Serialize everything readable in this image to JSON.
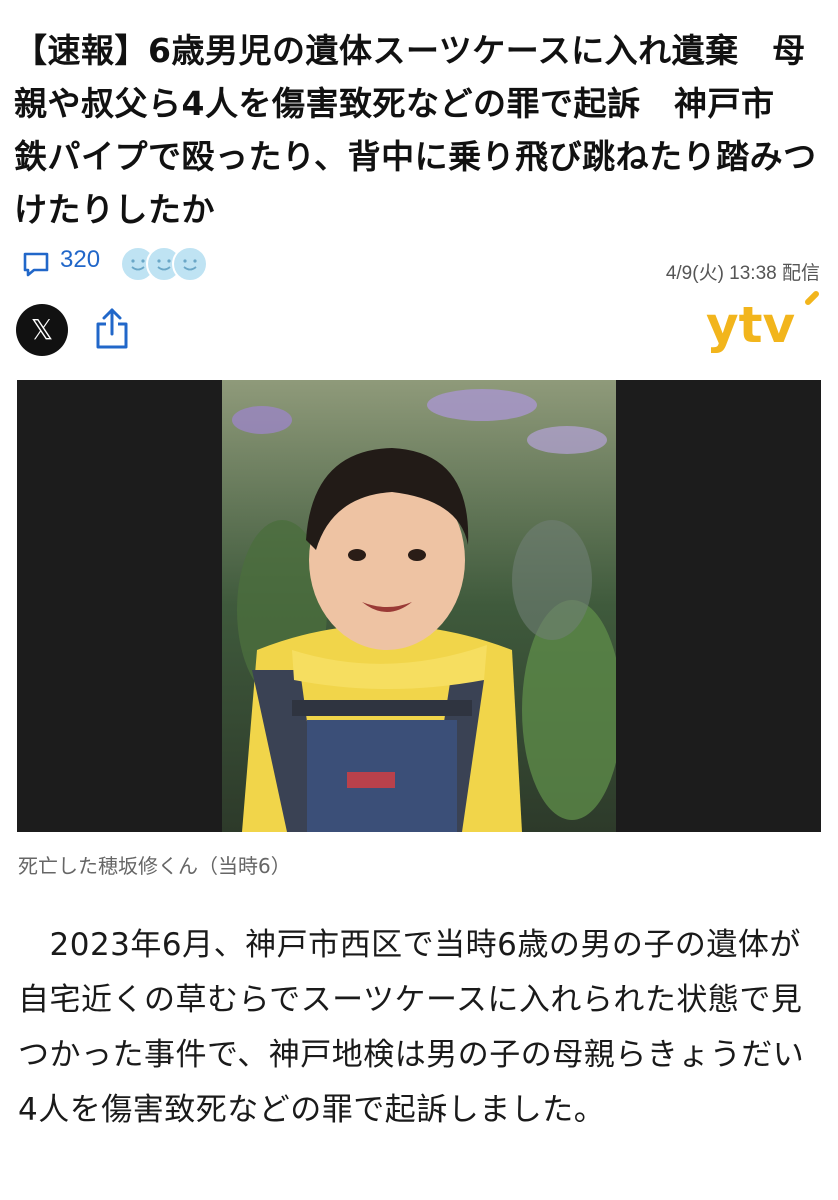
{
  "article": {
    "headline": "【速報】6歳男児の遺体スーツケースに入れ遺棄　母親や叔父ら4人を傷害致死などの罪で起訴　神戸市　鉄パイプで殴ったり、背中に乗り飛び跳ねたり踏みつけたりしたか",
    "comment_count": "320",
    "timestamp": "4/9(火) 13:38 配信",
    "share": {
      "x_label": "𝕏"
    },
    "publisher_logo_text": "ytv",
    "photo_caption": "死亡した穂坂修くん（当時6）",
    "body": "　2023年6月、神戸市西区で当時6歳の男の子の遺体が自宅近くの草むらでスーツケースに入れられた状態で見つかった事件で、神戸地検は男の子の母親らきょうだい4人を傷害致死などの罪で起訴しました。"
  },
  "colors": {
    "accent_blue": "#2167c9",
    "logo_yellow": "#f2b51c",
    "photo_bg": "#1c1c1c",
    "reaction_face": "#bfe3f3"
  },
  "icons": [
    "comment-icon",
    "reaction-face-icon",
    "x-icon",
    "share-icon",
    "ytv-logo"
  ]
}
